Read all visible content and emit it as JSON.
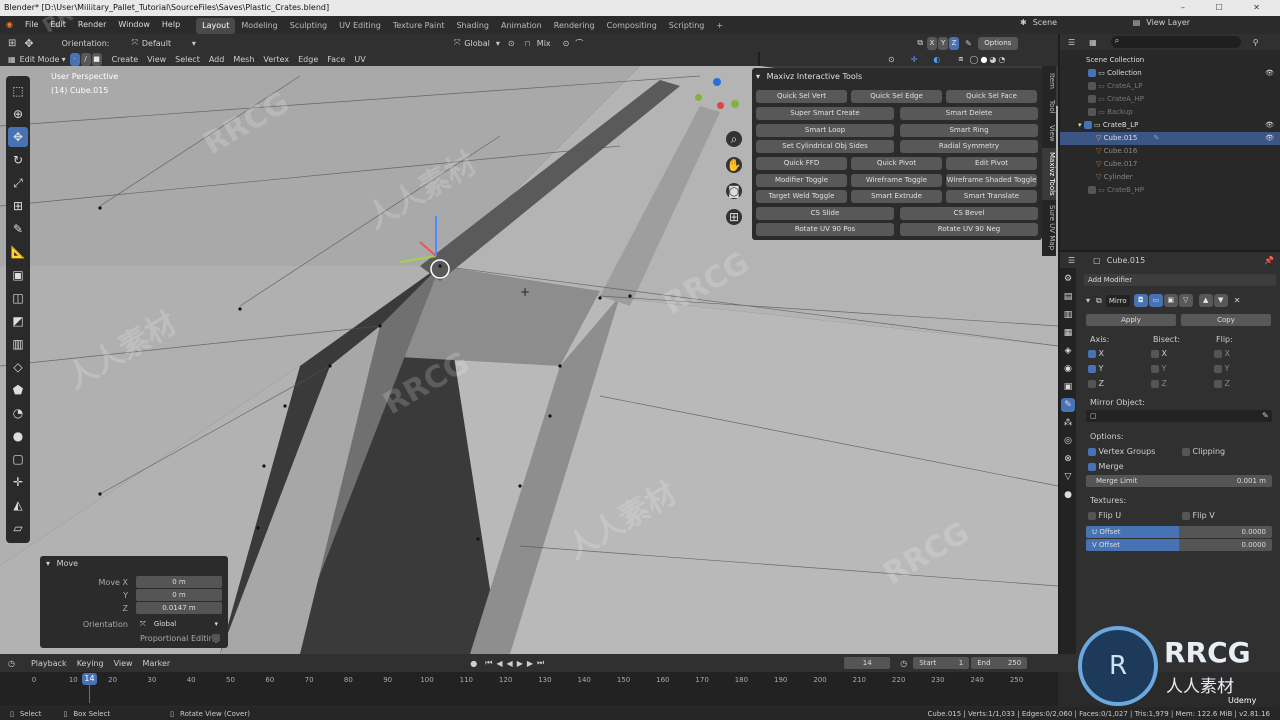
{
  "window": {
    "title": "Blender* [D:\\User\\Millitary_Pallet_Tutorial\\SourceFiles\\Saves\\Plastic_Crates.blend]",
    "controls": "– ☐ ✕"
  },
  "menu": {
    "items": [
      "File",
      "Edit",
      "Render",
      "Window",
      "Help"
    ]
  },
  "workspaces": [
    {
      "label": "Layout",
      "active": true
    },
    {
      "label": "Modeling"
    },
    {
      "label": "Sculpting"
    },
    {
      "label": "UV Editing"
    },
    {
      "label": "Texture Paint"
    },
    {
      "label": "Shading"
    },
    {
      "label": "Animation"
    },
    {
      "label": "Rendering"
    },
    {
      "label": "Compositing"
    },
    {
      "label": "Scripting"
    },
    {
      "label": "+"
    }
  ],
  "scene": {
    "label": "Scene",
    "view_layer": "View Layer"
  },
  "header": {
    "orientation_label": "Orientation:",
    "orientation_value": "Default",
    "transform": "Global",
    "snap_mode": "Mix",
    "axes": [
      "X",
      "Y",
      "Z"
    ],
    "options": "Options"
  },
  "header2": {
    "mode": "Edit Mode",
    "menus": [
      "Create",
      "View",
      "Select",
      "Add",
      "Mesh",
      "Vertex",
      "Edge",
      "Face",
      "UV"
    ]
  },
  "viewport": {
    "perspective": "User Perspective",
    "object": "(14) Cube.015"
  },
  "maxivz": {
    "title": "Maxivz Interactive Tools",
    "rows": [
      [
        "Quick Sel Vert",
        "Quick Sel Edge",
        "Quick Sel Face"
      ],
      [
        "Super Smart Create",
        "Smart Delete"
      ],
      [
        "Smart Loop",
        "Smart Ring"
      ],
      [
        "Set Cylindrical Obj Sides",
        "Radial Symmetry"
      ],
      [
        "Quick FFD",
        "Quick Pivot",
        "Edit Pivot"
      ],
      [
        "Modifier Toggle",
        "Wireframe Toggle",
        "Wireframe Shaded Toggle"
      ],
      [
        "Target Weld Toggle",
        "Smart Extrude",
        "Smart Translate"
      ],
      [
        "CS Slide",
        "CS Bevel"
      ],
      [
        "Rotate UV 90 Pos",
        "Rotate UV 90 Neg"
      ]
    ]
  },
  "ntabs": [
    "Item",
    "Tool",
    "View",
    "Maxivz Tools",
    "Sure UV Map"
  ],
  "move_panel": {
    "title": "Move",
    "move_x_label": "Move X",
    "move_x": "0 m",
    "y_label": "Y",
    "y": "0 m",
    "z_label": "Z",
    "z": "0.0147 m",
    "orientation_label": "Orientation",
    "orientation": "Global",
    "proportional": "Proportional Editing"
  },
  "outliner": {
    "root": "Scene Collection",
    "items": [
      {
        "name": "Collection",
        "level": 1
      },
      {
        "name": "CrateA_LP",
        "level": 1,
        "dim": true
      },
      {
        "name": "CrateA_HP",
        "level": 1,
        "dim": true
      },
      {
        "name": "Backup",
        "level": 1,
        "dim": true
      },
      {
        "name": "CrateB_LP",
        "level": 1
      },
      {
        "name": "Cube.015",
        "level": 2,
        "selected": true
      },
      {
        "name": "Cube.016",
        "level": 2,
        "dim": true
      },
      {
        "name": "Cube.017",
        "level": 2,
        "dim": true
      },
      {
        "name": "Cylinder",
        "level": 2,
        "dim": true
      },
      {
        "name": "CrateB_HP",
        "level": 1,
        "dim": true
      }
    ]
  },
  "properties": {
    "object": "Cube.015",
    "add_modifier": "Add Modifier",
    "modifier_name": "Mirro",
    "apply": "Apply",
    "copy": "Copy",
    "axis_label": "Axis:",
    "bisect_label": "Bisect:",
    "flip_label": "Flip:",
    "axes": [
      "X",
      "Y",
      "Z"
    ],
    "mirror_object": "Mirror Object:",
    "options_label": "Options:",
    "vertex_groups": "Vertex Groups",
    "clipping": "Clipping",
    "merge": "Merge",
    "merge_limit_label": "Merge Limit",
    "merge_limit": "0.001 m",
    "textures_label": "Textures:",
    "flip_u": "Flip U",
    "flip_v": "Flip V",
    "u_offset_label": "U Offset",
    "u_offset": "0.0000",
    "v_offset_label": "V Offset",
    "v_offset": "0.0000"
  },
  "timeline": {
    "menus": [
      "Playback",
      "Keying",
      "View",
      "Marker"
    ],
    "current_frame": "14",
    "start_label": "Start",
    "start": "1",
    "end_label": "End",
    "end": "250",
    "ticks": [
      "0",
      "10",
      "20",
      "30",
      "40",
      "50",
      "60",
      "70",
      "80",
      "90",
      "100",
      "110",
      "120",
      "130",
      "140",
      "150",
      "160",
      "170",
      "180",
      "190",
      "200",
      "210",
      "220",
      "230",
      "240",
      "250"
    ]
  },
  "status": {
    "select": "Select",
    "box_select": "Box Select",
    "rotate": "Rotate View (Cover)",
    "stats": "Cube.015 | Verts:1/1,033 | Edges:0/2,060 | Faces:0/1,027 | Tris:1,979 | Mem: 122.6 MiB | v2.81.16"
  },
  "watermark": {
    "text": "RRCG",
    "sub": "人人素材",
    "udemy": "Udemy"
  }
}
